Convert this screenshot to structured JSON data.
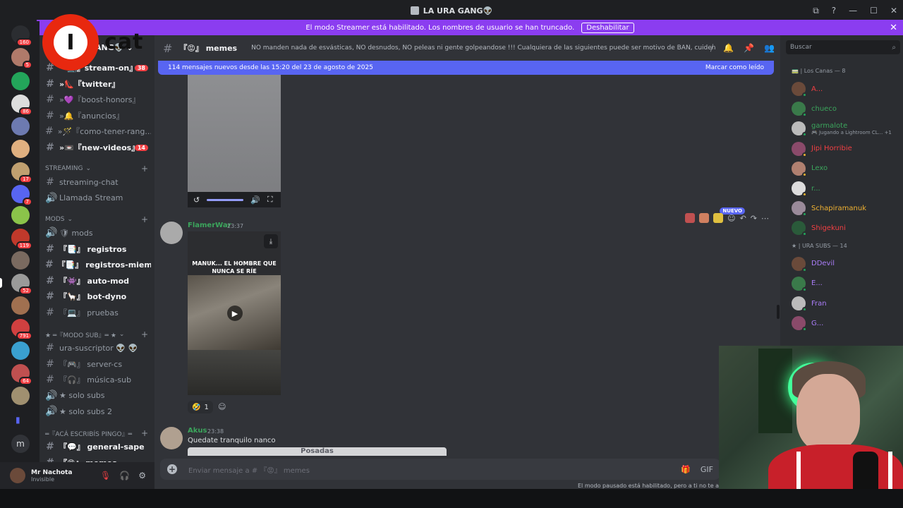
{
  "window": {
    "title": "LA URA GANG👽",
    "controls": [
      "⧉",
      "?",
      "—",
      "☐",
      "✕"
    ]
  },
  "streamer_bar": {
    "text": "El modo Streamer está habilitado. Los nombres de usuario se han truncado.",
    "button": "Deshabilitar",
    "close": "✕"
  },
  "overlay_logo": {
    "letter": "I",
    "text": "cat"
  },
  "guilds": [
    {
      "badge": "160",
      "color": "#2b2d31"
    },
    {
      "badge": "5",
      "color": "#b07a6a"
    },
    {
      "badge": "",
      "color": "#23a55a"
    },
    {
      "badge": "86",
      "color": "#ddd"
    },
    {
      "badge": "",
      "color": "#6d7ab0"
    },
    {
      "badge": "",
      "color": "#e0b080"
    },
    {
      "badge": "17",
      "color": "#c0a070"
    },
    {
      "badge": "7",
      "color": "#5865f2"
    },
    {
      "badge": "",
      "color": "#8bc34a"
    },
    {
      "badge": "119",
      "color": "#c0392b"
    },
    {
      "badge": "",
      "color": "#7a6a60"
    },
    {
      "badge": "52",
      "color": "#9a9a9a"
    },
    {
      "badge": "",
      "color": "#a07050"
    },
    {
      "badge": "791",
      "color": "#d04040"
    },
    {
      "badge": "",
      "color": "#3aa0d0"
    },
    {
      "badge": "64",
      "color": "#c05050"
    },
    {
      "badge": "",
      "color": "#a09070"
    }
  ],
  "guild_folder_icon": "▮",
  "guild_letter": "m",
  "server": {
    "name": "GANG👽",
    "chevron": "⌄"
  },
  "channels_top": [
    {
      "icon": "#",
      "label": "『📺』stream-on』",
      "badge": "38",
      "unread": true
    },
    {
      "icon": "#",
      "label": "»👠『twitter』",
      "badge": "",
      "unread": true
    },
    {
      "icon": "#",
      "label": "»💜『boost-honors』",
      "badge": "",
      "unread": false
    },
    {
      "icon": "#",
      "label": "»🔔『anuncios』",
      "badge": "",
      "unread": false
    },
    {
      "icon": "#",
      "label": "»🪄『como-tener-rang...",
      "badge": "",
      "unread": false
    },
    {
      "icon": "#",
      "label": "»📼『new-videos』",
      "badge": "14",
      "unread": true
    }
  ],
  "cat_streaming": {
    "label": "STREAMING",
    "chevron": "⌄",
    "plus": "+"
  },
  "channels_streaming": [
    {
      "icon": "#",
      "label": "streaming-chat"
    },
    {
      "icon": "🔊",
      "label": "Llamada Stream"
    }
  ],
  "cat_mods": {
    "label": "mods",
    "chevron": "⌄",
    "plus": "+"
  },
  "channels_mods": [
    {
      "icon": "🔊",
      "label": "🛡 mods",
      "unread": false
    },
    {
      "icon": "#",
      "label": "『📑』 registros",
      "unread": true
    },
    {
      "icon": "#",
      "label": "『📑』 registros-miem...",
      "unread": true
    },
    {
      "icon": "#",
      "label": "『👾』 auto-mod",
      "unread": true
    },
    {
      "icon": "#",
      "label": "『🦙』 bot-dyno",
      "unread": true
    },
    {
      "icon": "#",
      "label": "『💻』 pruebas",
      "unread": false
    }
  ],
  "cat_modo_sub": {
    "label": "★ ═『MODO SUB』═ ★",
    "chevron": "⌄",
    "plus": "+"
  },
  "channels_sub": [
    {
      "icon": "#",
      "label": "ura-suscriptor 👽 👽"
    },
    {
      "icon": "#",
      "label": "『🎮』 server-cs"
    },
    {
      "icon": "#",
      "label": "『🎧』 música-sub"
    },
    {
      "icon": "🔊",
      "label": "★ solo subs"
    },
    {
      "icon": "🔊",
      "label": "★ solo subs 2"
    }
  ],
  "cat_aca": {
    "label": "═『acá escribís pingo』═",
    "plus": "+"
  },
  "channels_aca": [
    {
      "icon": "#",
      "label": "『💬』 general-sape",
      "unread": true
    },
    {
      "icon": "#",
      "label": "『😡』 memes",
      "unread": true
    }
  ],
  "user_panel": {
    "name": "Mr Nachota",
    "status": "Invisible",
    "icons": [
      "🎙",
      "🎧",
      "⚙"
    ]
  },
  "channel_header": {
    "hash": "#",
    "name": "『😡』 memes",
    "topic": "NO manden nada de esvásticas, NO desnudos, NO peleas ni gente golpeandose !!! Cualquiera de las siguientes puede ser motivo de BAN, cuiden el stream!",
    "icons": [
      "⧸",
      "🔔",
      "📌",
      "👥"
    ]
  },
  "search": {
    "placeholder": "Buscar",
    "icon": "⌕"
  },
  "new_messages_bar": {
    "text": "114 mensajes nuevos desde las 15:20 del 23 de agosto de 2025",
    "action": "Marcar como leído"
  },
  "video_controls": {
    "replay": "↺",
    "volume": "🔊",
    "fullscreen": "⛶"
  },
  "message_actions": {
    "icons": [
      "☺",
      "↶",
      "↷",
      "⋯"
    ],
    "new_label": "NUEVO"
  },
  "messages": [
    {
      "author": "FlamerWar",
      "time": "23:37",
      "author_color": "#3ba55c",
      "video_caption": "MANUK... EL HOMBRE QUE NUNCA SE RÍE",
      "download_icon": "⤓",
      "play_icon": "▶",
      "reaction": {
        "emoji": "🤣",
        "count": "1"
      },
      "add_reaction_icon": "☺"
    },
    {
      "author": "Akus",
      "time": "23:38",
      "author_color": "#3ba55c",
      "text": "Quedate tranquilo nanco",
      "embed_title": "Posadas"
    }
  ],
  "composer": {
    "placeholder": "Enviar mensaje a # 『😡』 memes",
    "plus": "+",
    "icons": [
      "🎁",
      "GIF"
    ]
  },
  "slowmode_text": "El modo pausado está habilitado, pero a ti no te af",
  "member_groups": [
    {
      "label": "🚃 | Los Canas — 8",
      "members": [
        {
          "name": "A...",
          "color": "#f23f43",
          "status": "#23a55a",
          "sub": ""
        },
        {
          "name": "chueco",
          "color": "#3ba55c",
          "status": "#23a55a",
          "sub": ""
        },
        {
          "name": "garmalote",
          "color": "#3ba55c",
          "status": "#23a55a",
          "sub": "🎮 Jugando a Lightroom CL... +1"
        },
        {
          "name": "Jipi Horribie",
          "color": "#f23f43",
          "status": "#f0b232",
          "sub": ""
        },
        {
          "name": "Lexo",
          "color": "#3ba55c",
          "status": "#f0b232",
          "sub": ""
        },
        {
          "name": "r...",
          "color": "#3ba55c",
          "status": "#f0b232",
          "sub": ""
        },
        {
          "name": "Schapiramanuk",
          "color": "#f0b232",
          "status": "#23a55a",
          "sub": ""
        },
        {
          "name": "Shigekuni",
          "color": "#f23f43",
          "status": "#23a55a",
          "sub": ""
        }
      ]
    },
    {
      "label": "★ | URA SUBS — 14",
      "members": [
        {
          "name": "DDevil",
          "color": "#a97cf7",
          "status": "#23a55a",
          "sub": ""
        },
        {
          "name": "E...",
          "color": "#a97cf7",
          "status": "#23a55a",
          "sub": ""
        },
        {
          "name": "Fran",
          "color": "#a97cf7",
          "status": "#23a55a",
          "sub": ""
        },
        {
          "name": "G...",
          "color": "#a97cf7",
          "status": "#23a55a",
          "sub": ""
        }
      ]
    }
  ]
}
